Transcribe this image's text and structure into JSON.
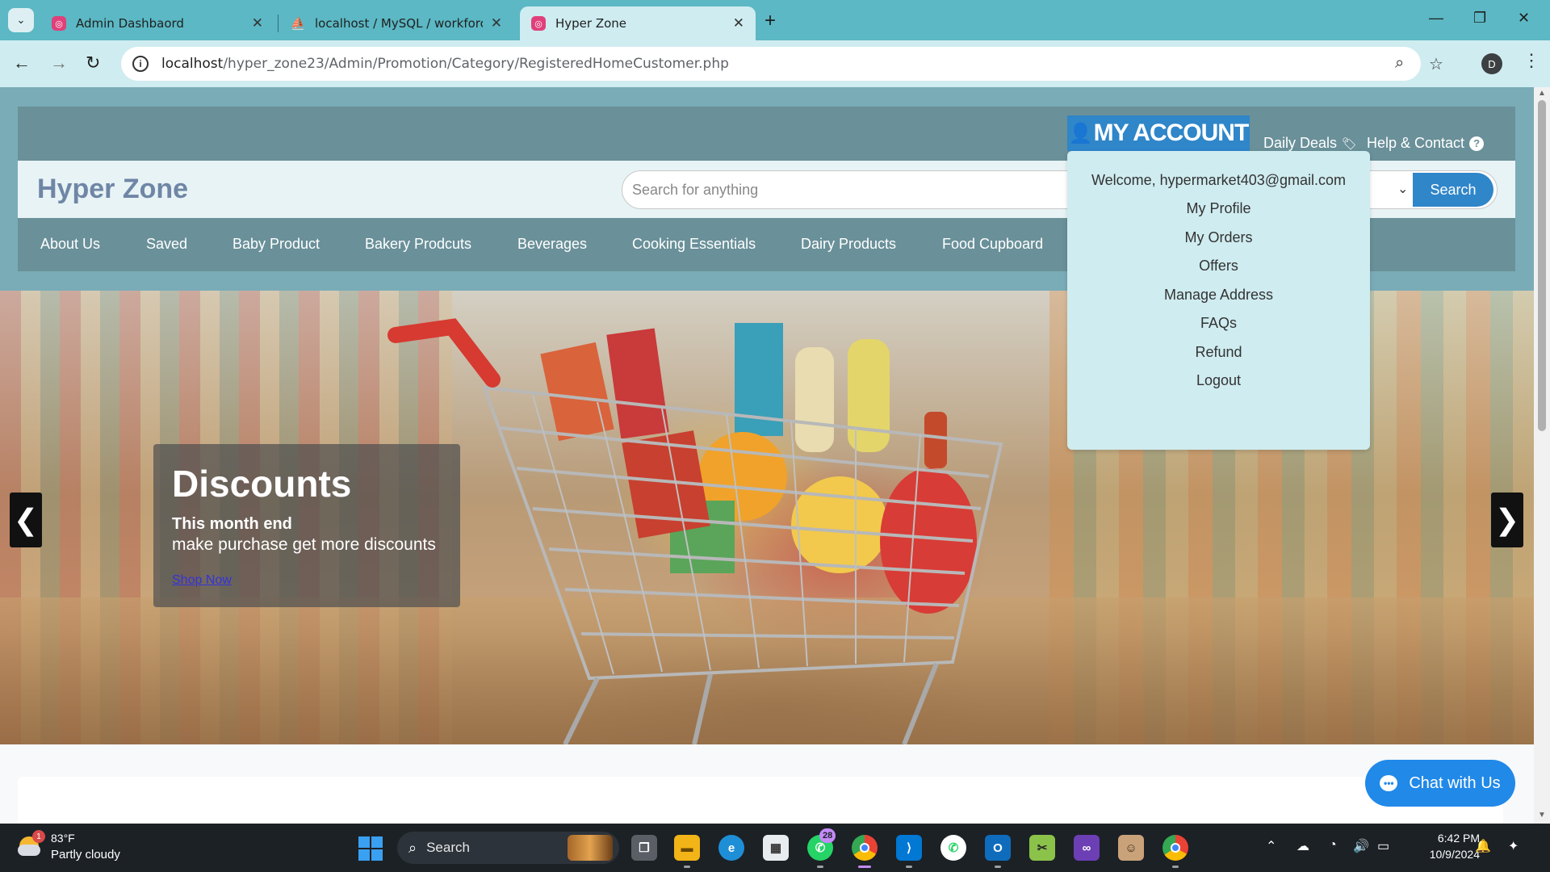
{
  "browser": {
    "tabs": [
      {
        "label": "Admin Dashbaord",
        "favicon": "app-favicon",
        "active": false
      },
      {
        "label": "localhost / MySQL / workforce",
        "favicon": "phpmyadmin-favicon",
        "active": false
      },
      {
        "label": "Hyper Zone",
        "favicon": "app-favicon",
        "active": true
      }
    ],
    "url_host": "localhost",
    "url_path": "/hyper_zone23/Admin/Promotion/Category/RegisteredHomeCustomer.php",
    "profile_initial": "D"
  },
  "page": {
    "top_links": {
      "my_account": "MY ACCOUNT",
      "daily_deals": "Daily Deals",
      "help_contact": "Help & Contact"
    },
    "brand": "Hyper Zone",
    "search": {
      "placeholder": "Search for anything",
      "button": "Search"
    },
    "categories": [
      "About Us",
      "Saved",
      "Baby Product",
      "Bakery Prodcuts",
      "Beverages",
      "Cooking Essentials",
      "Dairy Products",
      "Food Cupboard"
    ],
    "account_menu": [
      "Welcome, hypermarket403@gmail.com",
      "My Profile",
      "My Orders",
      "Offers",
      "Manage Address",
      "FAQs",
      "Refund",
      "Logout"
    ],
    "carousel": {
      "title": "Discounts",
      "subtitle": "This month end",
      "description": "make purchase get more discounts",
      "link": "Shop Now",
      "prev": "❮",
      "next": "❯"
    },
    "chat_button": "Chat with Us"
  },
  "taskbar": {
    "weather_temp": "83°F",
    "weather_cond": "Partly cloudy",
    "weather_badge": "1",
    "search_label": "Search",
    "whatsapp_badge": "28",
    "time": "6:42 PM",
    "date": "10/9/2024"
  },
  "colors": {
    "accent_blue": "#2f86c9",
    "nav_teal": "#6a9099",
    "chrome_teal": "#5bb8c4",
    "chat_blue": "#2189e8"
  }
}
